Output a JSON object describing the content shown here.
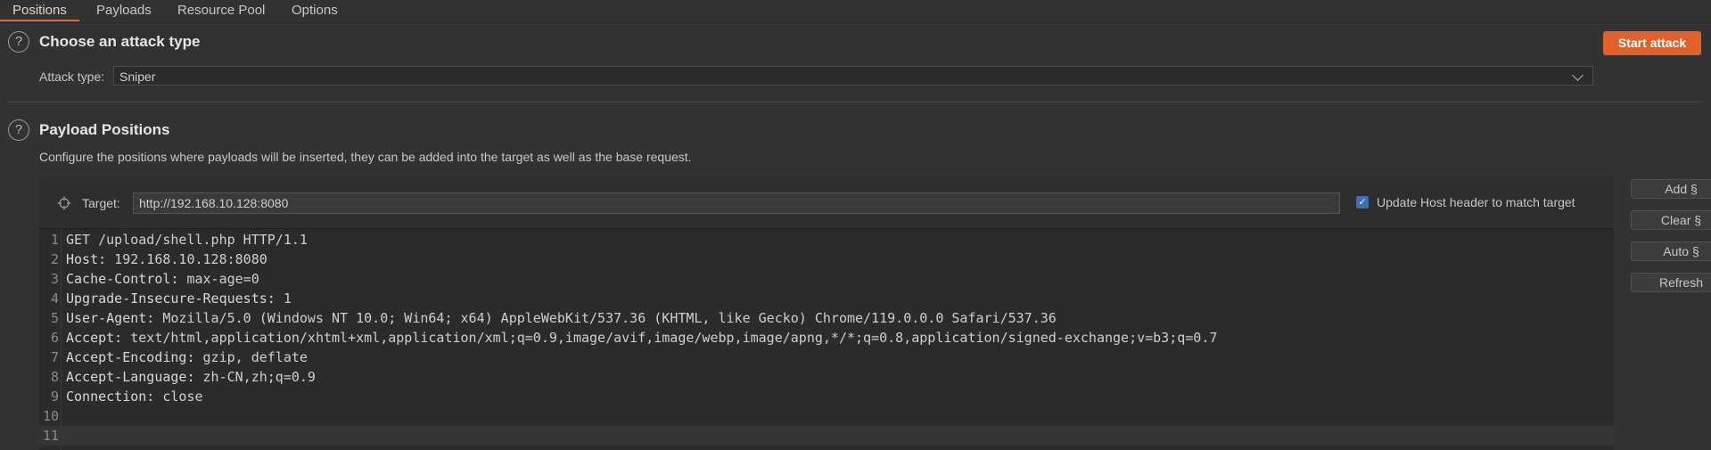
{
  "tabs": [
    "Positions",
    "Payloads",
    "Resource Pool",
    "Options"
  ],
  "attack": {
    "title": "Choose an attack type",
    "type_label": "Attack type:",
    "type_value": "Sniper",
    "start_label": "Start attack"
  },
  "positions": {
    "title": "Payload Positions",
    "description": "Configure the positions where payloads will be inserted, they can be added into the target as well as the base request.",
    "target_label": "Target:",
    "target_value": "http://192.168.10.128:8080",
    "update_host_label": "Update Host header to match target",
    "update_host_checked": true
  },
  "request_lines": [
    {
      "n": "1",
      "name": "",
      "value": "GET /upload/shell.php HTTP/1.1"
    },
    {
      "n": "2",
      "name": "Host:",
      "value": " 192.168.10.128:8080"
    },
    {
      "n": "3",
      "name": "Cache-Control:",
      "value": " max-age=0"
    },
    {
      "n": "4",
      "name": "Upgrade-Insecure-Requests:",
      "value": " 1"
    },
    {
      "n": "5",
      "name": "User-Agent:",
      "value": " Mozilla/5.0 (Windows NT 10.0; Win64; x64) AppleWebKit/537.36 (KHTML, like Gecko) Chrome/119.0.0.0 Safari/537.36"
    },
    {
      "n": "6",
      "name": "Accept:",
      "value": " text/html,application/xhtml+xml,application/xml;q=0.9,image/avif,image/webp,image/apng,*/*;q=0.8,application/signed-exchange;v=b3;q=0.7"
    },
    {
      "n": "7",
      "name": "Accept-Encoding:",
      "value": " gzip, deflate"
    },
    {
      "n": "8",
      "name": "Accept-Language:",
      "value": " zh-CN,zh;q=0.9"
    },
    {
      "n": "9",
      "name": "Connection:",
      "value": " close"
    },
    {
      "n": "10",
      "name": "",
      "value": ""
    },
    {
      "n": "11",
      "name": "",
      "value": ""
    }
  ],
  "side_buttons": [
    "Add §",
    "Clear §",
    "Auto §",
    "Refresh"
  ],
  "colors": {
    "accent": "#e0612b",
    "background": "#323232"
  },
  "icons": {
    "help": "question-circle-icon",
    "target": "crosshair-icon",
    "dropdown": "chevron-down-icon"
  }
}
